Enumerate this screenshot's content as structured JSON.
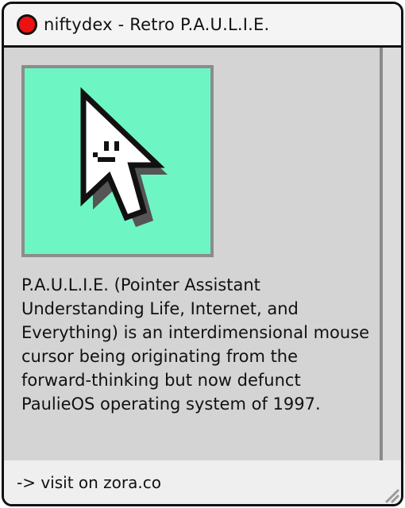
{
  "window": {
    "title": "niftydex - Retro P.A.U.L.I.E.",
    "colors": {
      "close_button": "#ee1111",
      "image_background": "#6ef5c4",
      "content_background": "#d4d4d4",
      "outline": "#111111"
    }
  },
  "content": {
    "image_icon": "pixel-arrow-cursor-with-smiley-face",
    "description": "P.A.U.L.I.E. (Pointer Assistant Understanding Life, Internet, and Everything) is an interdimensional mouse cursor being originating from the forward-thinking but now defunct PaulieOS operating system of 1997."
  },
  "footer": {
    "link_text": "-> visit on zora.co"
  }
}
